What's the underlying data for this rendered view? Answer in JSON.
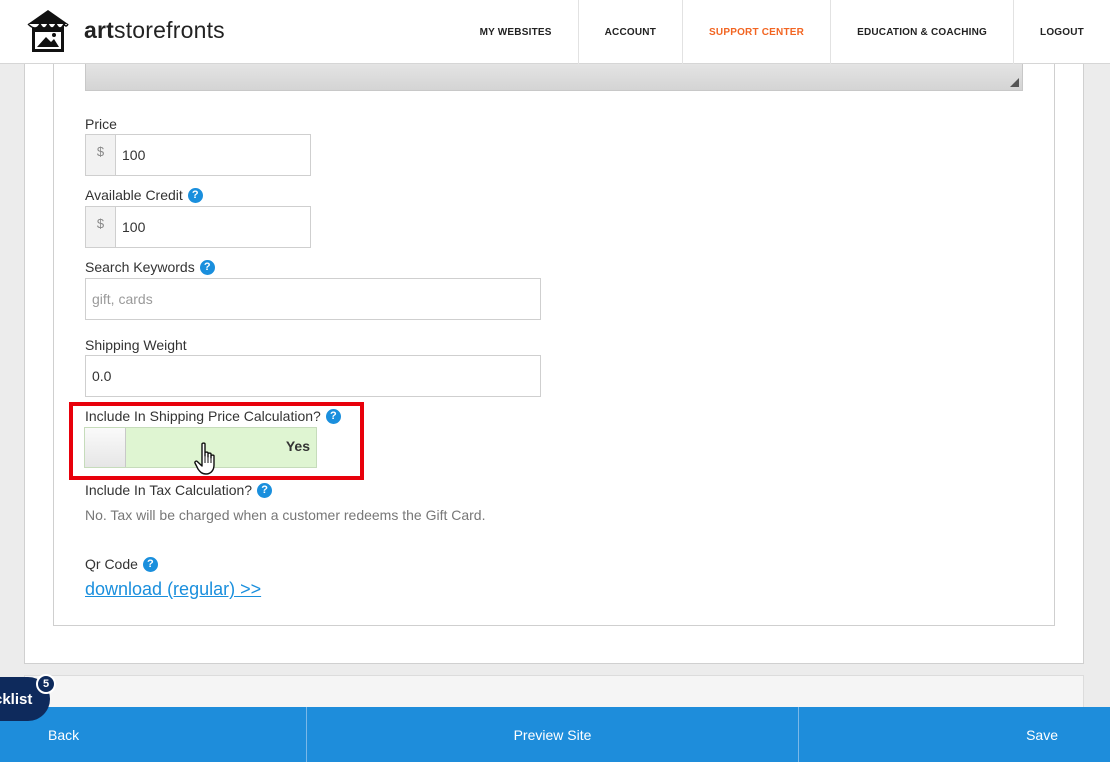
{
  "brand": {
    "prefix": "art",
    "suffix": "storefronts"
  },
  "nav": {
    "my_websites": "MY WEBSITES",
    "account": "ACCOUNT",
    "support_center": "SUPPORT CENTER",
    "education": "EDUCATION & COACHING",
    "logout": "LOGOUT",
    "active_color": "#f26522"
  },
  "form": {
    "price": {
      "label": "Price",
      "currency": "$",
      "value": "100"
    },
    "available_credit": {
      "label": "Available Credit",
      "currency": "$",
      "value": "100"
    },
    "search_keywords": {
      "label": "Search Keywords",
      "placeholder": "gift, cards"
    },
    "shipping_weight": {
      "label": "Shipping Weight",
      "value": "0.0"
    },
    "include_shipping": {
      "label": "Include In Shipping Price Calculation?",
      "toggle_value": "Yes"
    },
    "include_tax": {
      "label": "Include In Tax Calculation?",
      "note": "No. Tax will be charged when a customer redeems the Gift Card."
    },
    "qr_code": {
      "label": "Qr Code",
      "link": "download (regular) >>"
    }
  },
  "help_glyph": "?",
  "checklist": {
    "label": "cklist",
    "count": "5"
  },
  "bottom_bar": {
    "back": "Back",
    "preview": "Preview Site",
    "save": "Save"
  },
  "colors": {
    "accent_blue": "#1e8ddb",
    "highlight_red": "#e8000b",
    "toggle_green": "#dff5d2"
  }
}
